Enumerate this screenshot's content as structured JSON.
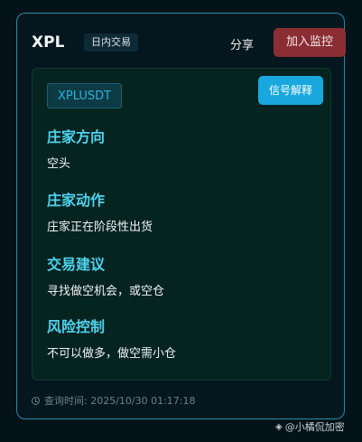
{
  "header": {
    "symbol": "XPL",
    "mode_tag": "日内交易",
    "share_label": "分享",
    "monitor_label": "加入监控"
  },
  "panel": {
    "pair": "XPLUSDT",
    "explain_label": "信号解释",
    "sections": [
      {
        "title": "庄家方向",
        "value": "空头"
      },
      {
        "title": "庄家动作",
        "value": "庄家正在阶段性出货"
      },
      {
        "title": "交易建议",
        "value": "寻找做空机会，或空仓"
      },
      {
        "title": "风险控制",
        "value": "不可以做多，做空需小仓"
      }
    ]
  },
  "footer": {
    "query_time": "查询时间: 2025/10/30 01:17:18"
  },
  "watermark": {
    "text": "@小橘侃加密",
    "icon": "logo-icon"
  },
  "colors": {
    "accent": "#4fd3ee",
    "border": "#1f8fb0",
    "danger_button": "#8a2e33",
    "info_button": "#18a8de"
  }
}
